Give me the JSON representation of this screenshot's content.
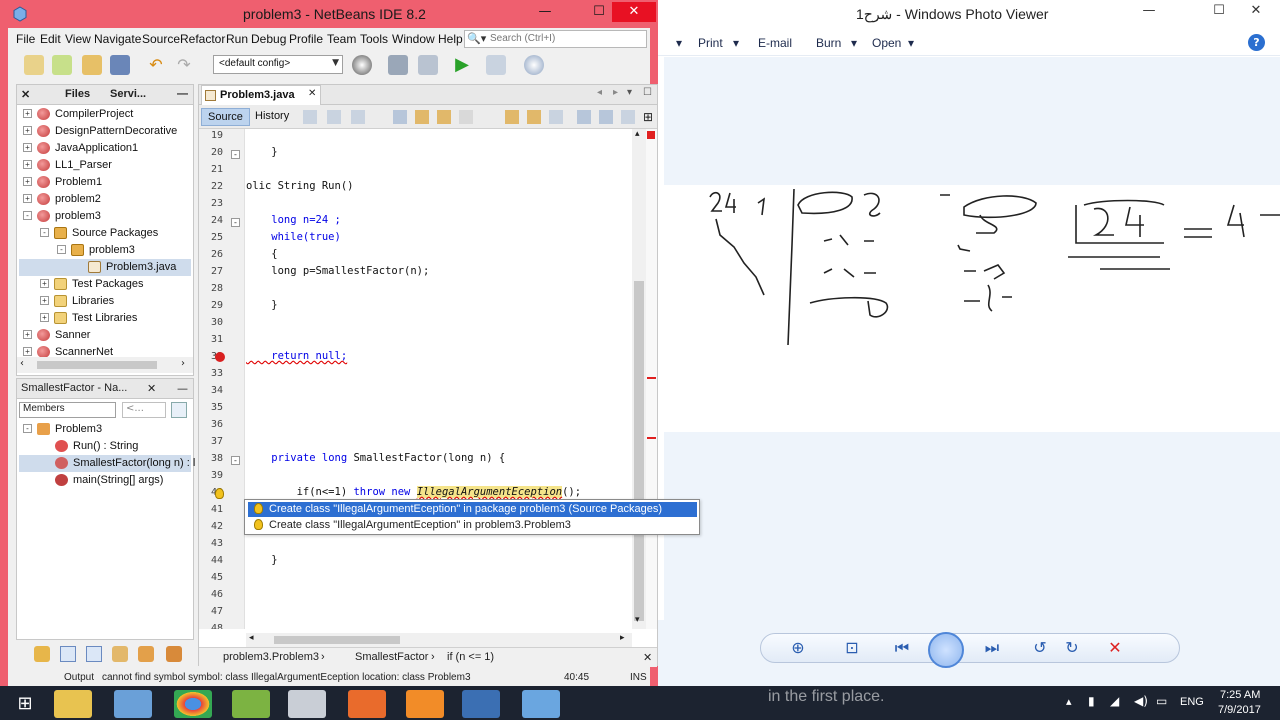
{
  "photo_viewer": {
    "title": "شرح1 - Windows Photo Viewer",
    "menu": [
      "Print",
      "E-mail",
      "Burn",
      "Open"
    ],
    "help": "?"
  },
  "netbeans": {
    "title": "problem3 - NetBeans IDE 8.2",
    "menu": [
      "File",
      "Edit",
      "View",
      "Navigate",
      "Source",
      "Refactor",
      "Run",
      "Debug",
      "Profile",
      "Team",
      "Tools",
      "Window",
      "Help"
    ],
    "search_placeholder": "Search (Ctrl+I)",
    "config": "<default config>",
    "projects_tabs": [
      "Files",
      "Servi..."
    ],
    "projects": [
      {
        "label": "CompilerProject",
        "icon": "project-icon",
        "indent": 0,
        "exp": "+"
      },
      {
        "label": "DesignPatternDecorative",
        "icon": "project-icon",
        "indent": 0,
        "exp": "+"
      },
      {
        "label": "JavaApplication1",
        "icon": "project-icon",
        "indent": 0,
        "exp": "+"
      },
      {
        "label": "LL1_Parser",
        "icon": "project-icon",
        "indent": 0,
        "exp": "+"
      },
      {
        "label": "Problem1",
        "icon": "project-icon",
        "indent": 0,
        "exp": "+"
      },
      {
        "label": "problem2",
        "icon": "project-icon",
        "indent": 0,
        "exp": "+"
      },
      {
        "label": "problem3",
        "icon": "project-icon",
        "indent": 0,
        "exp": "-"
      },
      {
        "label": "Source Packages",
        "icon": "package-icon",
        "indent": 1,
        "exp": "-"
      },
      {
        "label": "problem3",
        "icon": "package-icon",
        "indent": 2,
        "exp": "-"
      },
      {
        "label": "Problem3.java",
        "icon": "java-file-icon",
        "indent": 3,
        "exp": ""
      },
      {
        "label": "Test Packages",
        "icon": "folder-icon",
        "indent": 1,
        "exp": "+"
      },
      {
        "label": "Libraries",
        "icon": "folder-icon",
        "indent": 1,
        "exp": "+"
      },
      {
        "label": "Test Libraries",
        "icon": "folder-icon",
        "indent": 1,
        "exp": "+"
      },
      {
        "label": "Sanner",
        "icon": "project-icon",
        "indent": 0,
        "exp": "+"
      },
      {
        "label": "ScannerNet",
        "icon": "project-icon",
        "indent": 0,
        "exp": "+"
      }
    ],
    "navigator": {
      "title": "SmallestFactor - Na...",
      "filter": "Members",
      "filter2": "<...",
      "items": [
        {
          "label": "Problem3",
          "indent": 0
        },
        {
          "label": "Run() : String",
          "indent": 1
        },
        {
          "label": "SmallestFactor(long n) : l",
          "indent": 1
        },
        {
          "label": "main(String[] args)",
          "indent": 1
        }
      ]
    },
    "editor": {
      "tab": "Problem3.java",
      "source_label": "Source",
      "history_label": "History",
      "line_numbers": [
        "19",
        "20",
        "21",
        "22",
        "23",
        "24",
        "25",
        "26",
        "27",
        "28",
        "29",
        "30",
        "31",
        "32",
        "33",
        "34",
        "35",
        "36",
        "37",
        "38",
        "39",
        "40",
        "41",
        "42",
        "43",
        "44",
        "45",
        "46",
        "47",
        "48"
      ],
      "code": {
        "l20": "    }",
        "l22": "olic String Run()",
        "l24": "    long n=24 ;",
        "l25": "    while(true)",
        "l26": "    {",
        "l27": "    long p=SmallestFactor(n);",
        "l29": "    }",
        "l32": "    return null;",
        "l38_kw1": "private long",
        "l38_rest": " SmallestFactor(long n) {",
        "l40_pre": "        if(n<=1)",
        "l40_kw": " throw new ",
        "l40_hl": "IllegalArgumentEception",
        "l40_post": "();",
        "l44": "    }"
      },
      "breadcrumbs": [
        "problem3.Problem3",
        "SmallestFactor",
        "if (n <= 1)"
      ]
    },
    "popup": [
      "Create class \"IllegalArgumentEception\" in package problem3 (Source Packages)",
      "Create class \"IllegalArgumentEception\" in problem3.Problem3"
    ],
    "status": {
      "output": "Output",
      "message": "cannot find symbol   symbol:   class IllegalArgumentEception   location: class Problem3",
      "position": "40:45",
      "mode": "INS"
    }
  },
  "taskbar": {
    "overlay_text": "in the first place.",
    "lang": "ENG",
    "time": "7:25 AM",
    "date": "7/9/2017"
  },
  "colors": {
    "netbeans_frame": "#ef5f6f",
    "selection": "#2d6fd2",
    "keyword": "#0000e6"
  }
}
